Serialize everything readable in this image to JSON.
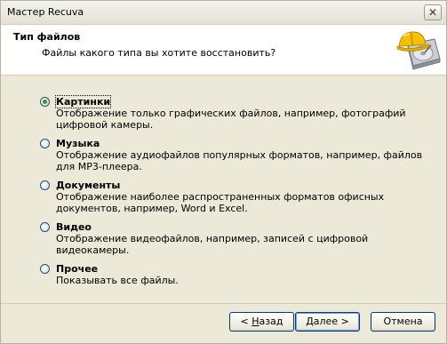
{
  "window": {
    "title": "Мастер Recuva",
    "close_symbol": "✕"
  },
  "header": {
    "title": "Тип файлов",
    "subtitle": "Файлы какого типа вы хотите восстановить?",
    "logo_icon": "recuva-hardhat-drive-icon"
  },
  "options": [
    {
      "label": "Картинки",
      "description": "Отображение только графических файлов, например, фотографий цифровой камеры.",
      "checked": true
    },
    {
      "label": "Музыка",
      "description": "Отображение аудиофайлов популярных форматов, например, файлов для MP3-плеера.",
      "checked": false
    },
    {
      "label": "Документы",
      "description": "Отображение наиболее распространенных форматов офисных документов, например, Word и Excel.",
      "checked": false
    },
    {
      "label": "Видео",
      "description": "Отображение видеофайлов, например, записей с цифровой видеокамеры.",
      "checked": false
    },
    {
      "label": "Прочее",
      "description": "Показывать все файлы.",
      "checked": false
    }
  ],
  "buttons": {
    "back_prefix": "< ",
    "back_accel": "Н",
    "back_rest": "азад",
    "next_label": "Далее >",
    "cancel_label": "Отмена"
  },
  "colors": {
    "dialog_bg": "#ece9d8",
    "radio_checked": "#21a121"
  }
}
